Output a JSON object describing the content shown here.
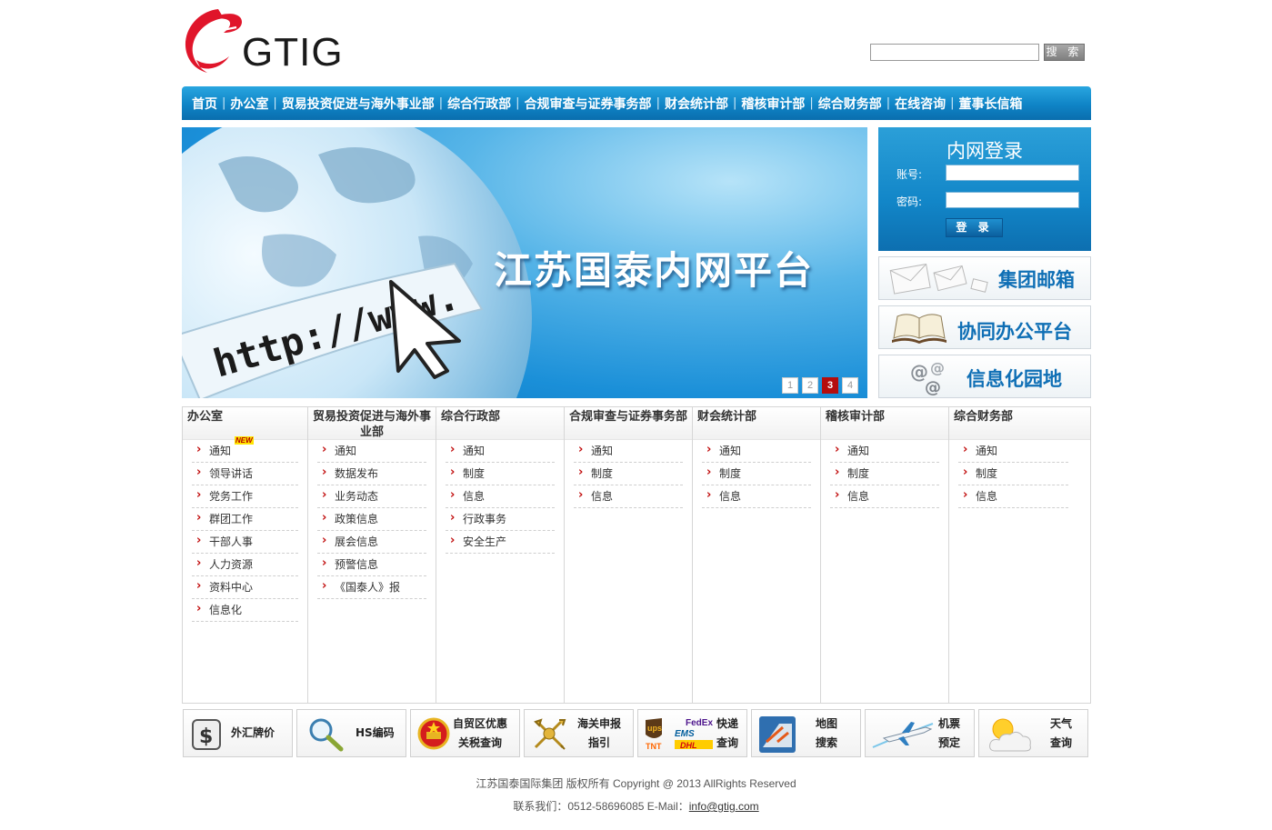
{
  "header": {
    "logo_text": "GTIG",
    "search": {
      "value": "",
      "button_label": "搜 索"
    }
  },
  "nav": {
    "items": [
      "首页",
      "办公室",
      "贸易投资促进与海外事业部",
      "综合行政部",
      "合规审查与证券事务部",
      "财会统计部",
      "稽核审计部",
      "综合财务部",
      "在线咨询",
      "董事长信箱"
    ],
    "separator": "|"
  },
  "banner": {
    "headline": "江苏国泰内网平台",
    "url_text": "http://www.",
    "pages": [
      "1",
      "2",
      "3",
      "4"
    ],
    "active_page": "3"
  },
  "login": {
    "title": "内网登录",
    "account_label": "账号:",
    "password_label": "密码:",
    "account_value": "",
    "password_value": "",
    "button_label": "登 录"
  },
  "quick_links": [
    "集团邮箱",
    "协同办公平台",
    "信息化园地"
  ],
  "departments": [
    {
      "name": "办公室",
      "items": [
        "通知",
        "领导讲话",
        "党务工作",
        "群团工作",
        "干部人事",
        "人力资源",
        "资料中心",
        "信息化"
      ],
      "new_badge": "NEW"
    },
    {
      "name": "贸易投资促进与海外事业部",
      "items": [
        "通知",
        "数据发布",
        "业务动态",
        "政策信息",
        "展会信息",
        "预警信息",
        "《国泰人》报"
      ]
    },
    {
      "name": "综合行政部",
      "items": [
        "通知",
        "制度",
        "信息",
        "行政事务",
        "安全生产"
      ]
    },
    {
      "name": "合规审查与证券事务部",
      "items": [
        "通知",
        "制度",
        "信息"
      ]
    },
    {
      "name": "财会统计部",
      "items": [
        "通知",
        "制度",
        "信息"
      ]
    },
    {
      "name": "稽核审计部",
      "items": [
        "通知",
        "制度",
        "信息"
      ]
    },
    {
      "name": "综合财务部",
      "items": [
        "通知",
        "制度",
        "信息"
      ]
    }
  ],
  "tools": [
    {
      "label": "外汇牌价",
      "icon": "currency-icon"
    },
    {
      "label": "HS编码",
      "icon": "magnifier-icon"
    },
    {
      "label": "自贸区优惠\n关税查询",
      "icon": "national-emblem-icon"
    },
    {
      "label": "海关申报\n指引",
      "icon": "customs-emblem-icon"
    },
    {
      "label": "快递\n查询",
      "icon": "courier-logos-icon",
      "logos": [
        "ups",
        "FedEx",
        "EMS",
        "DHL",
        "TNT"
      ]
    },
    {
      "label": "地图\n搜索",
      "icon": "map-icon"
    },
    {
      "label": "机票\n预定",
      "icon": "airplane-icon"
    },
    {
      "label": "天气\n查询",
      "icon": "weather-icon"
    }
  ],
  "footer": {
    "copyright": "江苏国泰国际集团 版权所有 Copyright @ 2013 AllRights Reserved",
    "contact_prefix": "联系我们：0512-58696085 E-Mail：",
    "email": "info@gtig.com"
  },
  "colors": {
    "nav_blue": "#1386c8",
    "brand_red": "#e0152a",
    "active_page_red": "#b50d0d",
    "link_blue": "#0f6fb5"
  }
}
